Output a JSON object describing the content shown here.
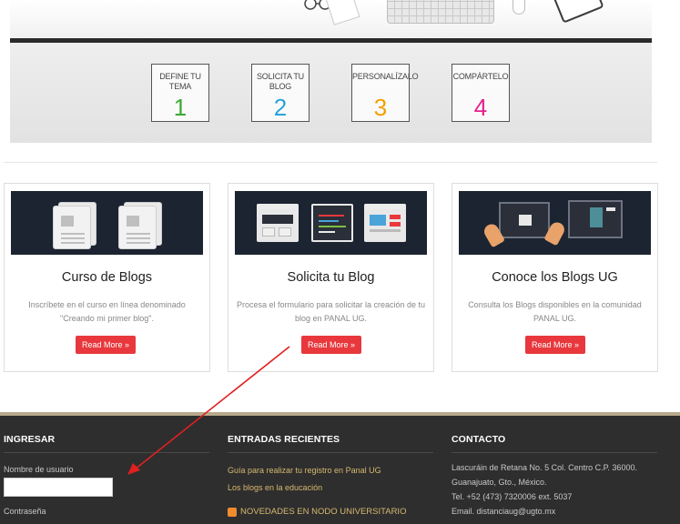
{
  "steps": [
    {
      "label": "DEFINE TU TEMA",
      "number": "1",
      "color": "#3aaa35"
    },
    {
      "label": "SOLICITA TU BLOG",
      "number": "2",
      "color": "#2aa3d9"
    },
    {
      "label": "PERSONALÍZALO",
      "number": "3",
      "color": "#f2a000"
    },
    {
      "label": "COMPÁRTELO",
      "number": "4",
      "color": "#e5208f"
    }
  ],
  "cards": [
    {
      "title": "Curso de Blogs",
      "description": "Inscríbete en el curso en línea denominado \"Creando mi primer blog\".",
      "button": "Read More »"
    },
    {
      "title": "Solicita tu Blog",
      "description": "Procesa el formulario para solicitar la creación de tu blog en PANAL UG.",
      "button": "Read More »"
    },
    {
      "title": "Conoce los Blogs UG",
      "description": "Consulta los Blogs disponibles en la comunidad PANAL UG.",
      "button": "Read More »"
    }
  ],
  "footer": {
    "login": {
      "heading": "INGRESAR",
      "username_label": "Nombre de usuario",
      "username_value": "",
      "password_label": "Contraseña"
    },
    "recent": {
      "heading": "ENTRADAS RECIENTES",
      "links": [
        "Guía para realizar tu registro en Panal UG",
        "Los blogs en la educación"
      ],
      "news": "NOVEDADES EN NODO UNIVERSITARIO"
    },
    "contact": {
      "heading": "CONTACTO",
      "lines": [
        "Lascuráin de Retana No. 5 Col. Centro C.P. 36000.",
        "Guanajuato, Gto., México.",
        "Tel. +52 (473) 7320006 ext. 5037",
        "Email. distanciaug@ugto.mx"
      ]
    }
  },
  "colors": {
    "accent_button": "#e8383d",
    "footer_bg": "#2e2e2e",
    "footer_link": "#d7b86f",
    "arrow": "#e02020"
  }
}
